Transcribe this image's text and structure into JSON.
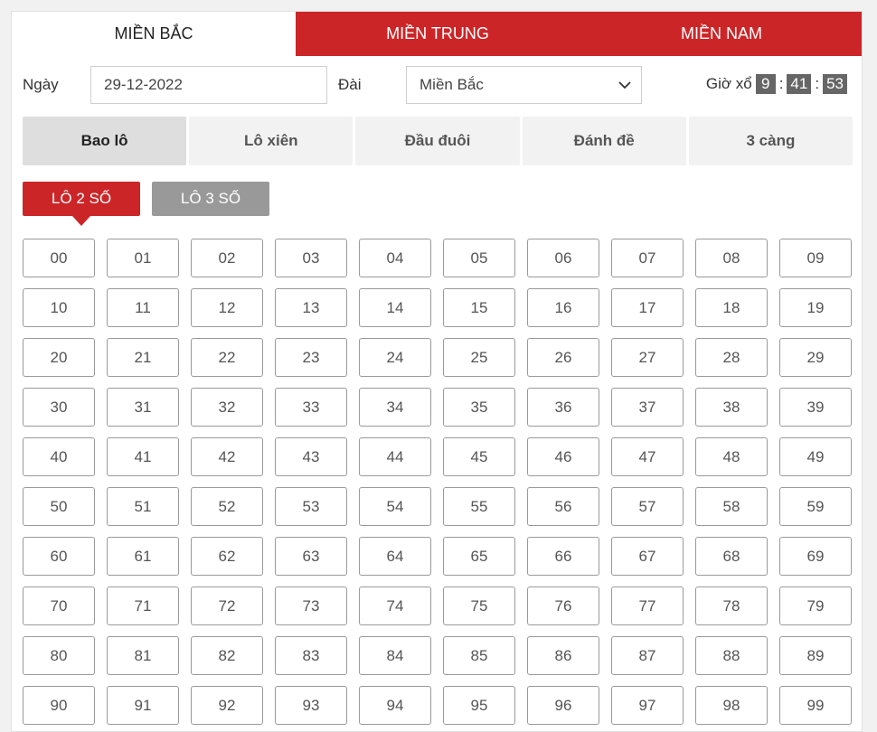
{
  "region_tabs": [
    {
      "label": "MIỀN BẮC",
      "active": true
    },
    {
      "label": "MIỀN TRUNG",
      "active": false
    },
    {
      "label": "MIỀN NAM",
      "active": false
    }
  ],
  "filters": {
    "date_label": "Ngày",
    "date_value": "29-12-2022",
    "station_label": "Đài",
    "station_value": "Miền Bắc",
    "draw_time_label": "Giờ xổ",
    "draw_time": {
      "h": "9",
      "m": "41",
      "s": "53"
    },
    "time_separator": ":"
  },
  "game_tabs": [
    {
      "label": "Bao lô",
      "active": true
    },
    {
      "label": "Lô xiên",
      "active": false
    },
    {
      "label": "Đầu đuôi",
      "active": false
    },
    {
      "label": "Đánh đề",
      "active": false
    },
    {
      "label": "3 càng",
      "active": false
    }
  ],
  "sub_tabs": [
    {
      "label": "LÔ 2 SỐ",
      "active": true
    },
    {
      "label": "LÔ 3 SỐ",
      "active": false
    }
  ],
  "numbers": [
    "00",
    "01",
    "02",
    "03",
    "04",
    "05",
    "06",
    "07",
    "08",
    "09",
    "10",
    "11",
    "12",
    "13",
    "14",
    "15",
    "16",
    "17",
    "18",
    "19",
    "20",
    "21",
    "22",
    "23",
    "24",
    "25",
    "26",
    "27",
    "28",
    "29",
    "30",
    "31",
    "32",
    "33",
    "34",
    "35",
    "36",
    "37",
    "38",
    "39",
    "40",
    "41",
    "42",
    "43",
    "44",
    "45",
    "46",
    "47",
    "48",
    "49",
    "50",
    "51",
    "52",
    "53",
    "54",
    "55",
    "56",
    "57",
    "58",
    "59",
    "60",
    "61",
    "62",
    "63",
    "64",
    "65",
    "66",
    "67",
    "68",
    "69",
    "70",
    "71",
    "72",
    "73",
    "74",
    "75",
    "76",
    "77",
    "78",
    "79",
    "80",
    "81",
    "82",
    "83",
    "84",
    "85",
    "86",
    "87",
    "88",
    "89",
    "90",
    "91",
    "92",
    "93",
    "94",
    "95",
    "96",
    "97",
    "98",
    "99"
  ],
  "colors": {
    "accent": "#cc2528",
    "inactive_sub_tab": "#999999",
    "active_game_tab": "#dedede",
    "game_tab": "#f2f2f2",
    "digit_box": "#666666"
  }
}
